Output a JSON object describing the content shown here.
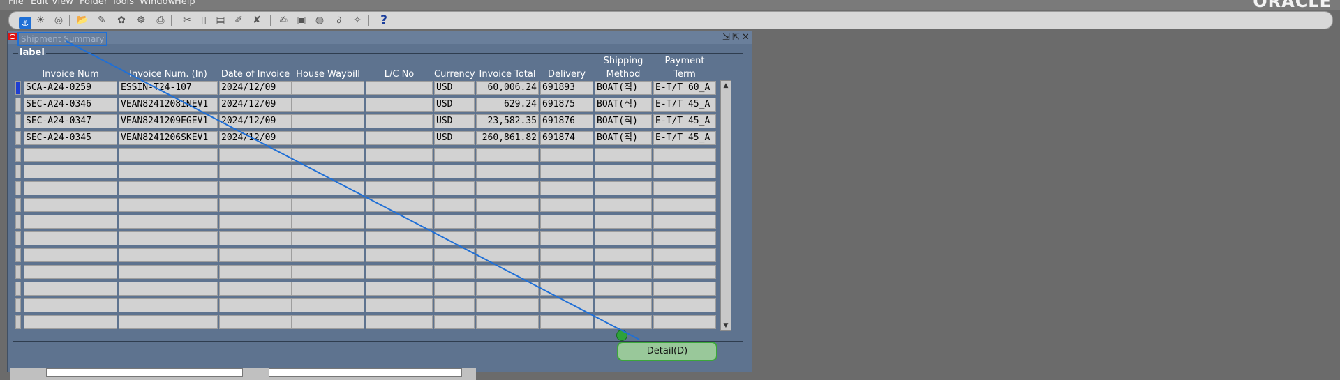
{
  "menu": {
    "items": [
      "File",
      "Edit",
      "View",
      "Folder",
      "Tools",
      "Window",
      "Help"
    ],
    "brand": "ORACLE"
  },
  "toolbar": {
    "icons": [
      "anchor-icon",
      "flashlight-icon",
      "navigator-icon",
      "folder-open-icon",
      "save-icon",
      "refresh-icon",
      "print-icon",
      "zoom-icon",
      "cut-icon",
      "copy-icon",
      "paste-icon",
      "clear-record-icon",
      "delete-record-icon",
      "edit-icon",
      "attachments-icon",
      "folder-icon",
      "paperclip-icon",
      "translate-icon"
    ],
    "help_label": "?"
  },
  "window": {
    "title": "Shipment Summary",
    "controls": [
      "minimize-icon",
      "restore-icon",
      "close-icon"
    ]
  },
  "group": {
    "label": "label"
  },
  "table": {
    "columns": [
      {
        "line1": "",
        "line2": "Invoice Num"
      },
      {
        "line1": "",
        "line2": "Invoice Num. (In)"
      },
      {
        "line1": "",
        "line2": "Date of Invoice"
      },
      {
        "line1": "",
        "line2": "House Waybill"
      },
      {
        "line1": "",
        "line2": "L/C No"
      },
      {
        "line1": "",
        "line2": "Currency"
      },
      {
        "line1": "",
        "line2": "Invoice Total"
      },
      {
        "line1": "",
        "line2": "Delivery"
      },
      {
        "line1": "Shipping",
        "line2": "Method"
      },
      {
        "line1": "Payment",
        "line2": "Term"
      }
    ],
    "rows": [
      [
        "SCA-A24-0259",
        "ESSIN-T24-107",
        "2024/12/09",
        "",
        "",
        "USD",
        "60,006.24",
        "691893",
        "BOAT(직)",
        "E-T/T 60_A"
      ],
      [
        "SEC-A24-0346",
        "VEAN8241208INEV1",
        "2024/12/09",
        "",
        "",
        "USD",
        "629.24",
        "691875",
        "BOAT(직)",
        "E-T/T 45_A"
      ],
      [
        "SEC-A24-0347",
        "VEAN8241209EGEV1",
        "2024/12/09",
        "",
        "",
        "USD",
        "23,582.35",
        "691876",
        "BOAT(직)",
        "E-T/T 45_A"
      ],
      [
        "SEC-A24-0345",
        "VEAN8241206SKEV1",
        "2024/12/09",
        "",
        "",
        "USD",
        "260,861.82",
        "691874",
        "BOAT(직)",
        "E-T/T 45_A"
      ]
    ],
    "visible_row_count": 15
  },
  "buttons": {
    "detail_label": "Detail(D)"
  }
}
